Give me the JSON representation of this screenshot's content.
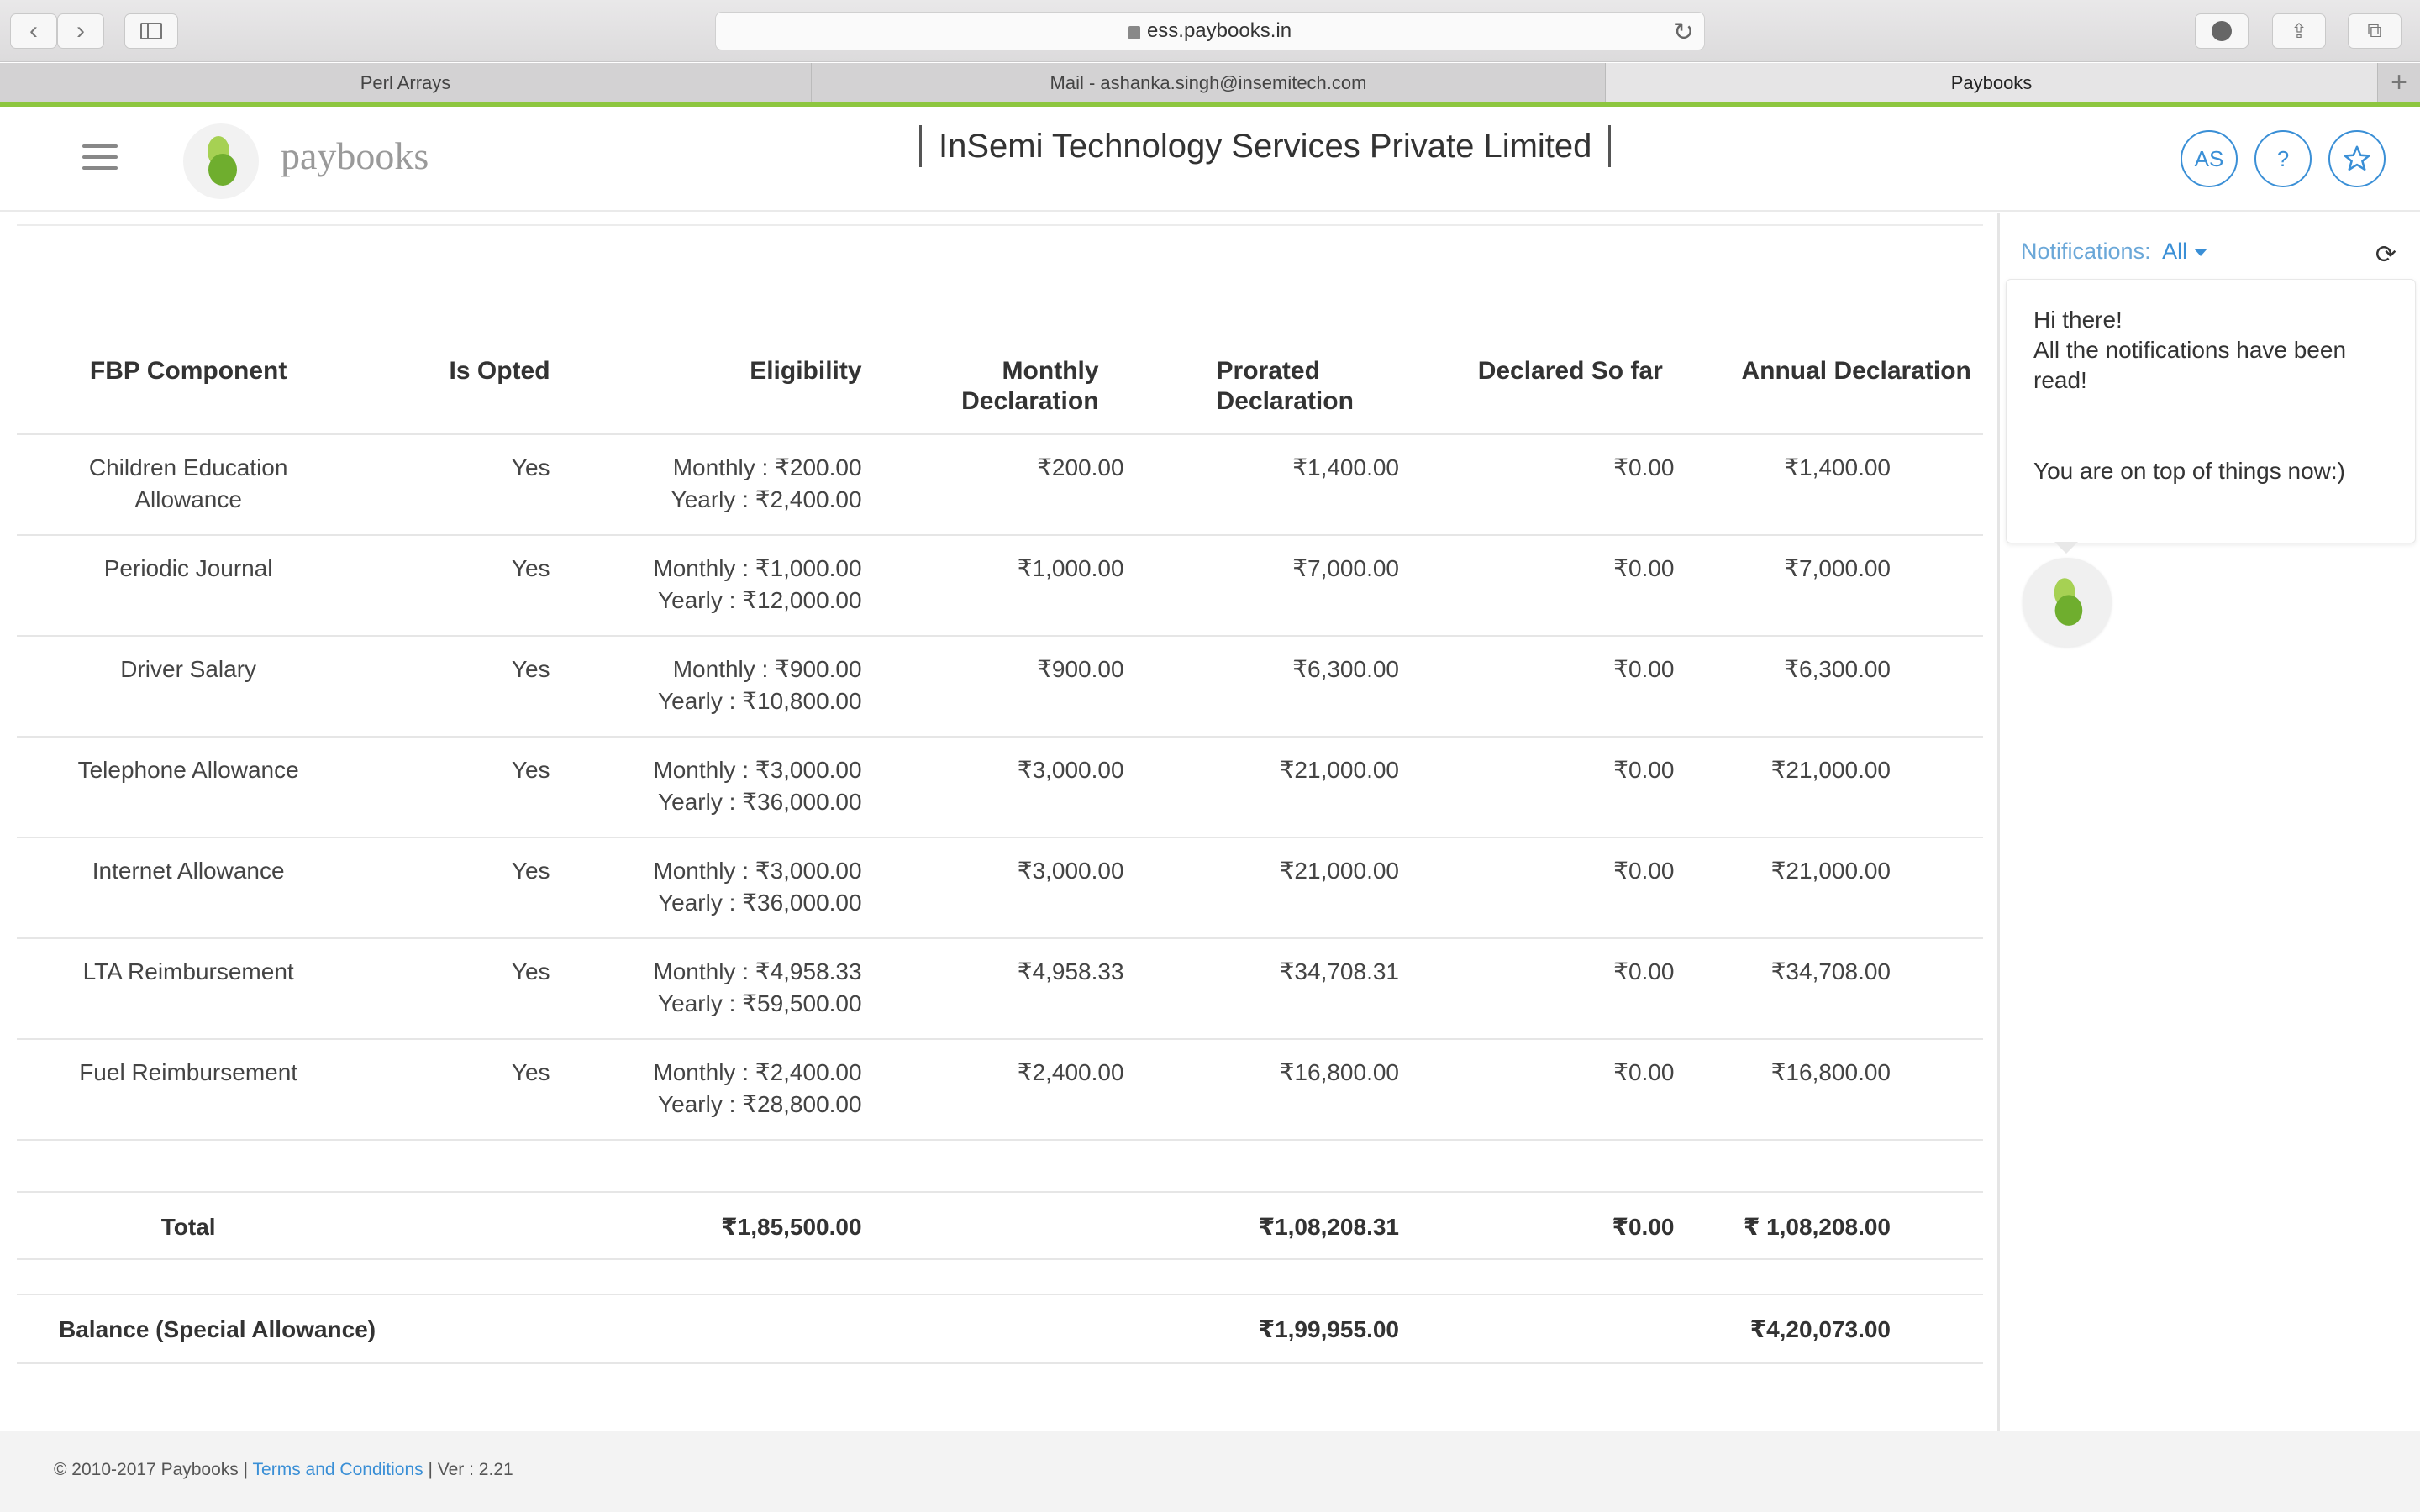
{
  "browser": {
    "url": "ess.paybooks.in",
    "tabs": [
      "Perl Arrays",
      "Mail - ashanka.singh@insemitech.com",
      "Paybooks"
    ]
  },
  "header": {
    "brand": "paybooks",
    "company": "InSemi Technology Services Private Limited",
    "avatar_initials": "AS",
    "help_label": "?"
  },
  "table": {
    "headers": {
      "component": "FBP Component",
      "opted": "Is Opted",
      "eligibility": "Eligibility",
      "monthly_1": "Monthly",
      "monthly_2": "Declaration",
      "prorated_1": "Prorated",
      "prorated_2": "Declaration",
      "declared": "Declared So far",
      "annual": "Annual Declaration"
    },
    "rows": [
      {
        "component": "Children Education Allowance",
        "opted": "Yes",
        "elig_monthly": "Monthly : ₹200.00",
        "elig_yearly": "Yearly : ₹2,400.00",
        "monthly": "₹200.00",
        "prorated": "₹1,400.00",
        "declared": "₹0.00",
        "annual": "₹1,400.00"
      },
      {
        "component": "Periodic Journal",
        "opted": "Yes",
        "elig_monthly": "Monthly : ₹1,000.00",
        "elig_yearly": "Yearly : ₹12,000.00",
        "monthly": "₹1,000.00",
        "prorated": "₹7,000.00",
        "declared": "₹0.00",
        "annual": "₹7,000.00"
      },
      {
        "component": "Driver Salary",
        "opted": "Yes",
        "elig_monthly": "Monthly : ₹900.00",
        "elig_yearly": "Yearly : ₹10,800.00",
        "monthly": "₹900.00",
        "prorated": "₹6,300.00",
        "declared": "₹0.00",
        "annual": "₹6,300.00"
      },
      {
        "component": "Telephone Allowance",
        "opted": "Yes",
        "elig_monthly": "Monthly : ₹3,000.00",
        "elig_yearly": "Yearly : ₹36,000.00",
        "monthly": "₹3,000.00",
        "prorated": "₹21,000.00",
        "declared": "₹0.00",
        "annual": "₹21,000.00"
      },
      {
        "component": "Internet Allowance",
        "opted": "Yes",
        "elig_monthly": "Monthly : ₹3,000.00",
        "elig_yearly": "Yearly : ₹36,000.00",
        "monthly": "₹3,000.00",
        "prorated": "₹21,000.00",
        "declared": "₹0.00",
        "annual": "₹21,000.00"
      },
      {
        "component": "LTA Reimbursement",
        "opted": "Yes",
        "elig_monthly": "Monthly : ₹4,958.33",
        "elig_yearly": "Yearly : ₹59,500.00",
        "monthly": "₹4,958.33",
        "prorated": "₹34,708.31",
        "declared": "₹0.00",
        "annual": "₹34,708.00"
      },
      {
        "component": "Fuel Reimbursement",
        "opted": "Yes",
        "elig_monthly": "Monthly : ₹2,400.00",
        "elig_yearly": "Yearly : ₹28,800.00",
        "monthly": "₹2,400.00",
        "prorated": "₹16,800.00",
        "declared": "₹0.00",
        "annual": "₹16,800.00"
      }
    ],
    "total": {
      "label": "Total",
      "eligibility": "₹1,85,500.00",
      "prorated": "₹1,08,208.31",
      "declared": "₹0.00",
      "annual": "₹ 1,08,208.00"
    },
    "balance": {
      "label": "Balance (Special Allowance)",
      "prorated": "₹1,99,955.00",
      "annual": "₹4,20,073.00"
    }
  },
  "notifications": {
    "label": "Notifications:",
    "filter": "All",
    "line1": "Hi there!",
    "line2": "All the notifications have been read!",
    "line3": "You are on top of things now:)"
  },
  "footer": {
    "copyright": "© 2010-2017 Paybooks | ",
    "terms": "Terms and Conditions",
    "version": " | Ver : 2.21"
  },
  "colors": {
    "accent_green": "#8dc63f",
    "link_blue": "#3a8fd6"
  }
}
